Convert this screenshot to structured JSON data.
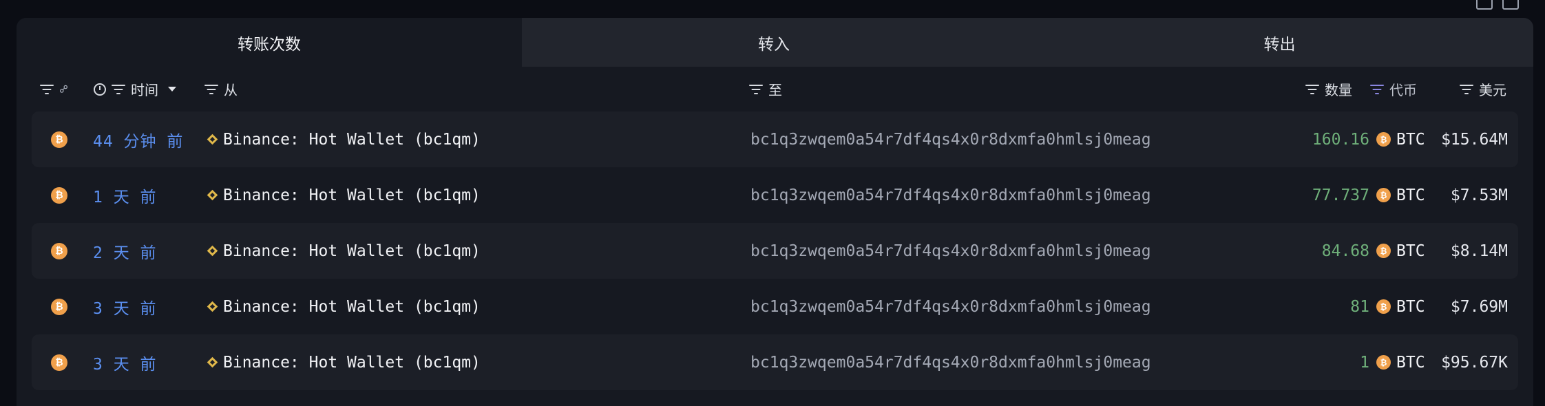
{
  "tabs": [
    "转账次数",
    "转入",
    "转出"
  ],
  "columns": {
    "time": "时间",
    "from": "从",
    "to": "至",
    "amount": "数量",
    "token": "代币",
    "usd": "美元"
  },
  "rows": [
    {
      "time": "44 分钟 前",
      "from": "Binance: Hot Wallet (bc1qm)",
      "to": "bc1q3zwqem0a54r7df4qs4x0r8dxmfa0hmlsj0meag",
      "amount": "160.16",
      "token": "BTC",
      "usd": "$15.64M"
    },
    {
      "time": "1 天 前",
      "from": "Binance: Hot Wallet (bc1qm)",
      "to": "bc1q3zwqem0a54r7df4qs4x0r8dxmfa0hmlsj0meag",
      "amount": "77.737",
      "token": "BTC",
      "usd": "$7.53M"
    },
    {
      "time": "2 天 前",
      "from": "Binance: Hot Wallet (bc1qm)",
      "to": "bc1q3zwqem0a54r7df4qs4x0r8dxmfa0hmlsj0meag",
      "amount": "84.68",
      "token": "BTC",
      "usd": "$8.14M"
    },
    {
      "time": "3 天 前",
      "from": "Binance: Hot Wallet (bc1qm)",
      "to": "bc1q3zwqem0a54r7df4qs4x0r8dxmfa0hmlsj0meag",
      "amount": "81",
      "token": "BTC",
      "usd": "$7.69M"
    },
    {
      "time": "3 天 前",
      "from": "Binance: Hot Wallet (bc1qm)",
      "to": "bc1q3zwqem0a54r7df4qs4x0r8dxmfa0hmlsj0meag",
      "amount": "1",
      "token": "BTC",
      "usd": "$95.67K"
    }
  ],
  "coin_symbol": "₿",
  "colors": {
    "time": "#5b8ff0",
    "amount": "#6fb07a",
    "coin": "#f0a04b",
    "accent_filter": "#8a86e0"
  }
}
